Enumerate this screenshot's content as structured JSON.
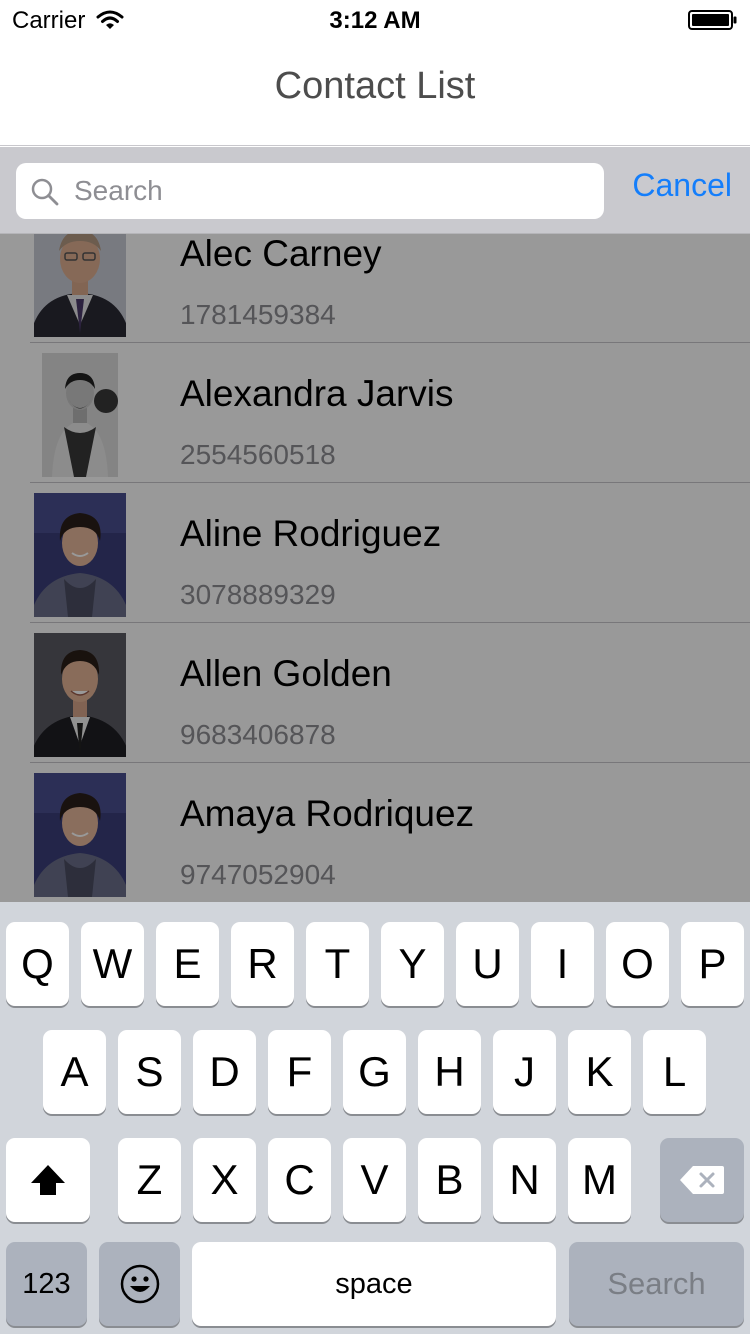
{
  "status_bar": {
    "carrier": "Carrier",
    "time": "3:12 AM"
  },
  "nav": {
    "title": "Contact List"
  },
  "search": {
    "placeholder": "Search",
    "value": "",
    "cancel_label": "Cancel"
  },
  "contacts": [
    {
      "name": "Alec Carney",
      "phone": "1781459384"
    },
    {
      "name": "Alexandra Jarvis",
      "phone": "2554560518"
    },
    {
      "name": "Aline Rodriguez",
      "phone": "3078889329"
    },
    {
      "name": "Allen Golden",
      "phone": "9683406878"
    },
    {
      "name": "Amaya Rodriquez",
      "phone": "9747052904"
    }
  ],
  "keyboard": {
    "row1": [
      "Q",
      "W",
      "E",
      "R",
      "T",
      "Y",
      "U",
      "I",
      "O",
      "P"
    ],
    "row2": [
      "A",
      "S",
      "D",
      "F",
      "G",
      "H",
      "J",
      "K",
      "L"
    ],
    "row3": [
      "Z",
      "X",
      "C",
      "V",
      "B",
      "N",
      "M"
    ],
    "numbers_label": "123",
    "space_label": "space",
    "search_label": "Search",
    "icons": {
      "shift": "shift-icon",
      "delete": "delete-icon",
      "emoji": "emoji-icon"
    }
  },
  "colors": {
    "accent": "#147efb",
    "keyboard_bg": "#d1d5db",
    "dim_overlay": "rgba(0,0,0,0.40)"
  }
}
